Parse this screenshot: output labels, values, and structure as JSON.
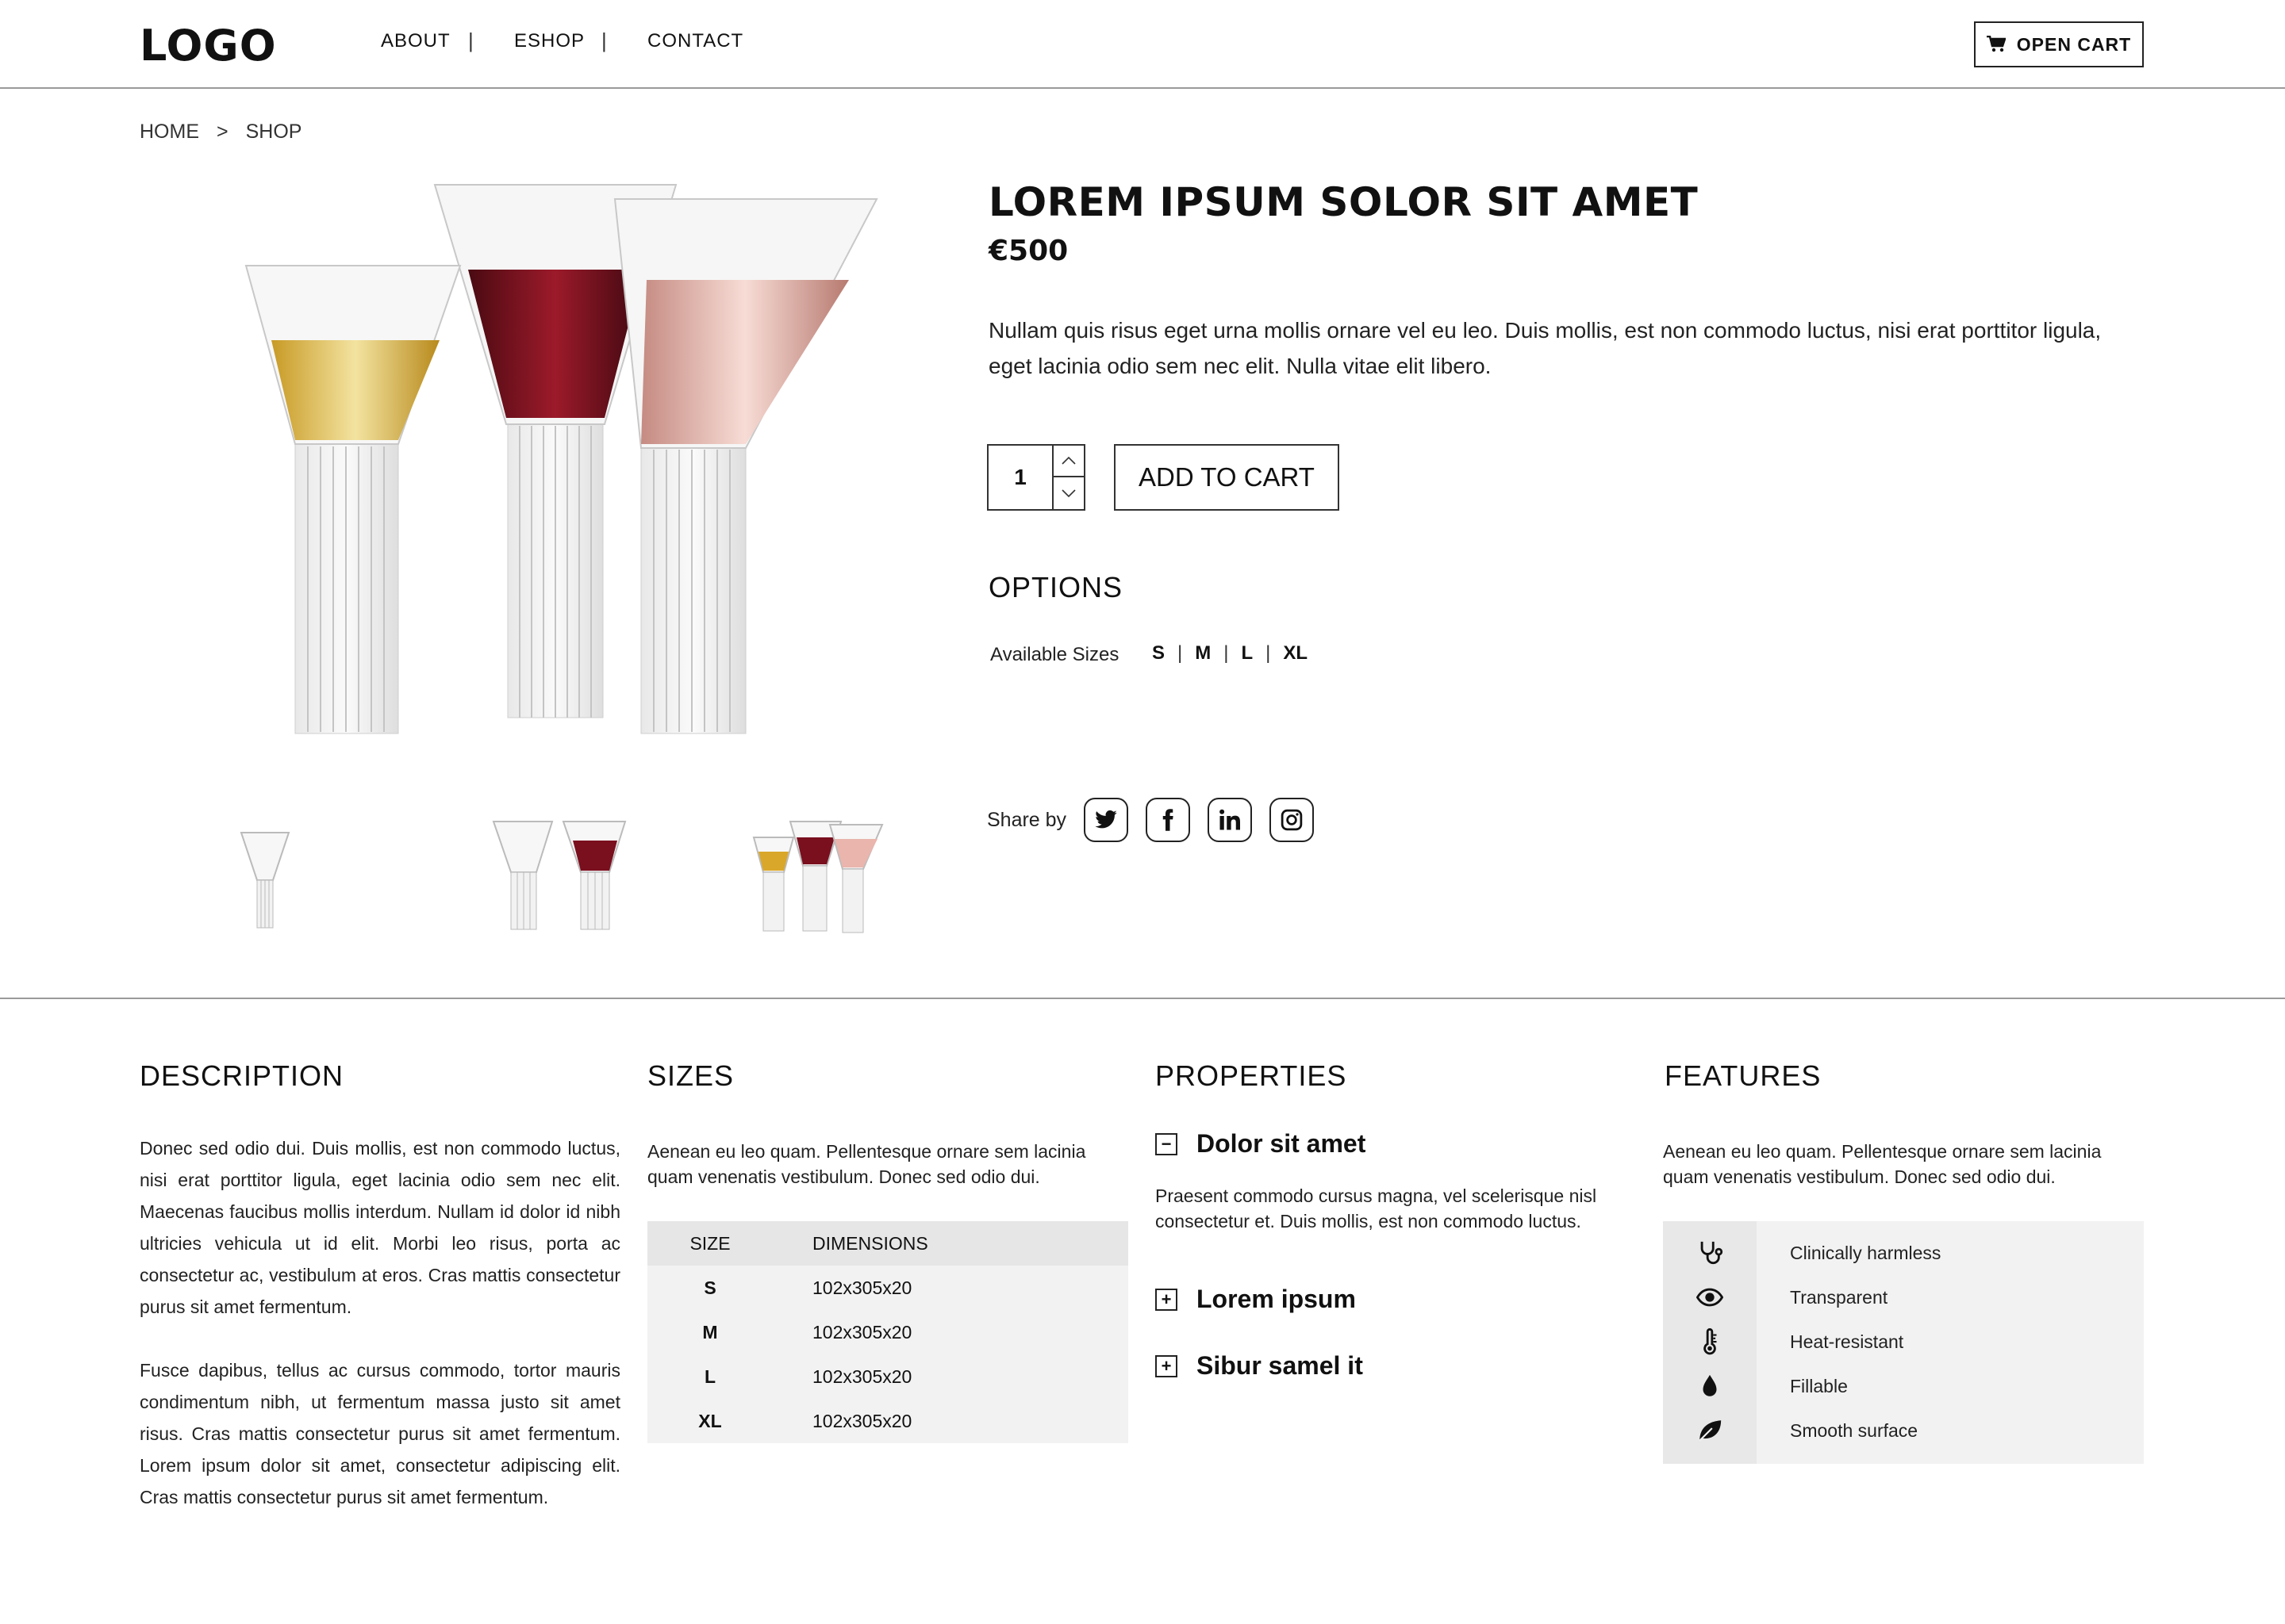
{
  "header": {
    "logo": "LOGO",
    "nav": [
      "ABOUT",
      "ESHOP",
      "CONTACT"
    ],
    "nav_separator": "|",
    "cart_label": "OPEN CART"
  },
  "breadcrumb": {
    "home": "HOME",
    "separator": ">",
    "current": "SHOP"
  },
  "product": {
    "title": "LOREM IPSUM SOLOR SIT AMET",
    "price": "€500",
    "description": "Nullam quis risus eget urna mollis ornare vel eu leo. Duis mollis, est non commodo luctus, nisi erat porttitor ligula, eget lacinia odio sem nec elit. Nulla vitae elit libero.",
    "quantity": "1",
    "add_to_cart": "ADD TO CART",
    "options_title": "OPTIONS",
    "sizes_label": "Available Sizes",
    "sizes": [
      "S",
      "M",
      "L",
      "XL"
    ],
    "size_separator": "|",
    "share_label": "Share by",
    "share_icons": [
      "twitter-icon",
      "facebook-icon",
      "linkedin-icon",
      "instagram-icon"
    ]
  },
  "sections": {
    "description": {
      "title": "DESCRIPTION",
      "p1": "Donec sed odio dui. Duis mollis, est non commodo luctus, nisi erat porttitor ligula, eget lacinia odio sem nec elit. Maecenas faucibus mollis interdum. Nullam id dolor id nibh ultricies vehicula ut id elit. Morbi leo risus, porta ac consectetur ac, vestibulum at eros. Cras mattis consectetur purus sit amet fermentum.",
      "p2": "Fusce dapibus, tellus ac cursus commodo, tortor mauris condimentum nibh, ut fermentum massa justo sit amet risus. Cras mattis consectetur purus sit amet fermentum. Lorem ipsum dolor sit amet, consectetur adipiscing elit. Cras mattis consectetur purus sit amet fermentum."
    },
    "sizes": {
      "title": "SIZES",
      "text": "Aenean eu leo quam. Pellentesque ornare sem lacinia quam venenatis vestibulum. Donec sed odio dui.",
      "table_headers": [
        "SIZE",
        "DIMENSIONS"
      ],
      "rows": [
        {
          "size": "S",
          "dim": "102x305x20"
        },
        {
          "size": "M",
          "dim": "102x305x20"
        },
        {
          "size": "L",
          "dim": "102x305x20"
        },
        {
          "size": "XL",
          "dim": "102x305x20"
        }
      ]
    },
    "properties": {
      "title": "PROPERTIES",
      "items": [
        {
          "label": "Dolor sit amet",
          "toggle": "−",
          "open": true,
          "text": "Praesent commodo cursus magna, vel scelerisque nisl consectetur et. Duis mollis, est non commodo luctus."
        },
        {
          "label": "Lorem ipsum",
          "toggle": "+",
          "open": false
        },
        {
          "label": "Sibur samel it",
          "toggle": "+",
          "open": false
        }
      ]
    },
    "features": {
      "title": "FEATURES",
      "text": "Aenean eu leo quam. Pellentesque ornare sem lacinia quam venenatis vestibulum. Donec sed odio dui.",
      "items": [
        {
          "icon": "stethoscope-icon",
          "label": "Clinically harmless"
        },
        {
          "icon": "eye-icon",
          "label": "Transparent"
        },
        {
          "icon": "thermometer-icon",
          "label": "Heat-resistant"
        },
        {
          "icon": "droplet-icon",
          "label": "Fillable"
        },
        {
          "icon": "leaf-icon",
          "label": "Smooth surface"
        }
      ]
    }
  },
  "colors": {
    "text": "#111111",
    "divider": "#9a9a9a",
    "table_bg": "#f2f2f2",
    "wine_red": "#7a0f1e",
    "rose": "#e9b5ad",
    "amber": "#d9a72a"
  }
}
